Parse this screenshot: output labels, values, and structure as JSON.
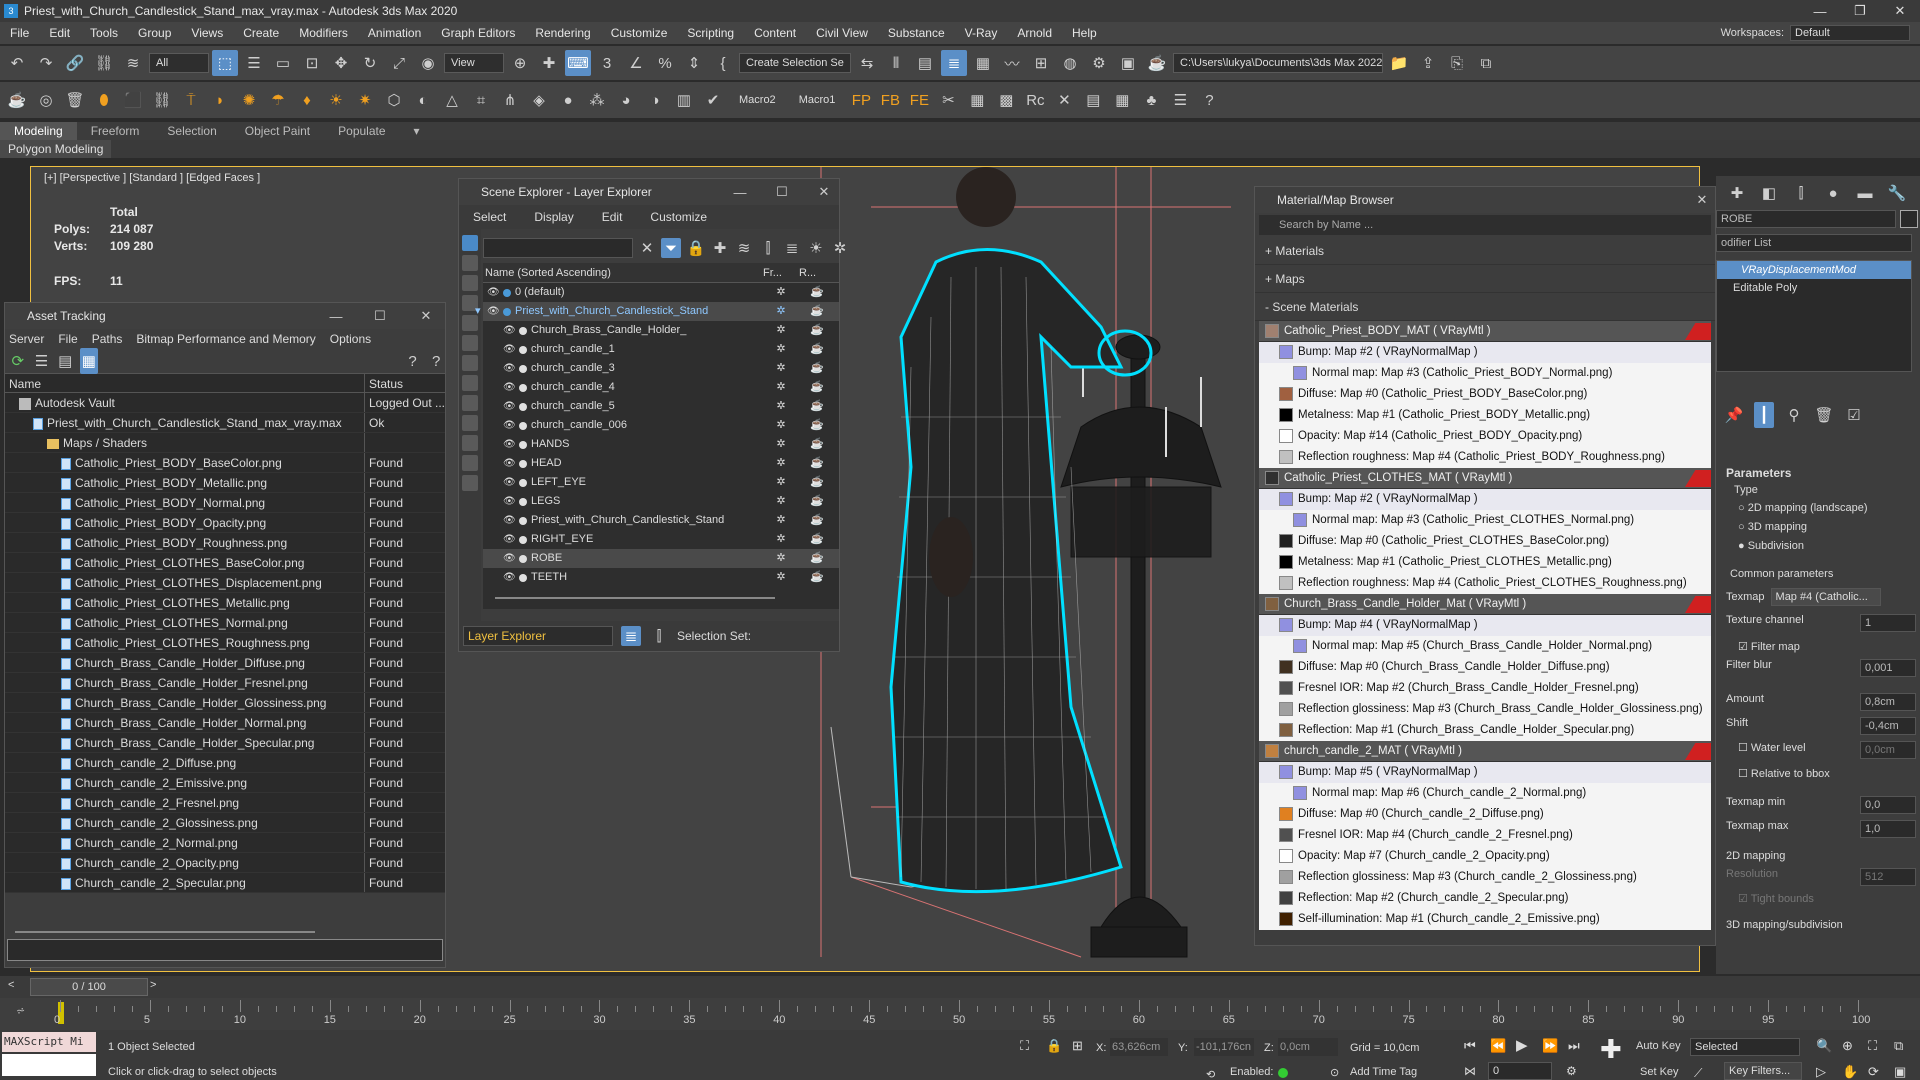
{
  "window": {
    "title": "Priest_with_Church_Candlestick_Stand_max_vray.max - Autodesk 3ds Max 2020"
  },
  "menu": [
    "File",
    "Edit",
    "Tools",
    "Group",
    "Views",
    "Create",
    "Modifiers",
    "Animation",
    "Graph Editors",
    "Rendering",
    "Customize",
    "Scripting",
    "Content",
    "Civil View",
    "Substance",
    "V-Ray",
    "Arnold",
    "Help"
  ],
  "workspace": {
    "label": "Workspaces:",
    "value": "Default"
  },
  "toolbar1": {
    "filter": "All",
    "refcoord": "View",
    "selection_set": "Create Selection Se",
    "project_path": "C:\\Users\\lukya\\Documents\\3ds Max 2022"
  },
  "toolbar2": {
    "macro2": "Macro2",
    "macro1": "Macro1"
  },
  "ribbon": {
    "tabs": [
      "Modeling",
      "Freeform",
      "Selection",
      "Object Paint",
      "Populate"
    ],
    "sub": "Polygon Modeling"
  },
  "viewport": {
    "label": "[+] [Perspective ] [Standard ] [Edged Faces ]",
    "stats": {
      "total": "Total",
      "polys_label": "Polys:",
      "polys": "214 087",
      "verts_label": "Verts:",
      "verts": "109 280",
      "fps_label": "FPS:",
      "fps": "11"
    }
  },
  "asset_tracking": {
    "title": "Asset Tracking",
    "menu": [
      "Server",
      "File",
      "Paths",
      "Bitmap Performance and Memory",
      "Options"
    ],
    "columns": [
      "Name",
      "Status"
    ],
    "rows": [
      {
        "name": "Autodesk Vault",
        "status": "Logged Out ...",
        "indent": 1,
        "kind": "vault"
      },
      {
        "name": "Priest_with_Church_Candlestick_Stand_max_vray.max",
        "status": "Ok",
        "indent": 2,
        "kind": "file"
      },
      {
        "name": "Maps / Shaders",
        "status": "",
        "indent": 3,
        "kind": "folder"
      },
      {
        "name": "Catholic_Priest_BODY_BaseColor.png",
        "status": "Found",
        "indent": 4,
        "kind": "file"
      },
      {
        "name": "Catholic_Priest_BODY_Metallic.png",
        "status": "Found",
        "indent": 4,
        "kind": "file"
      },
      {
        "name": "Catholic_Priest_BODY_Normal.png",
        "status": "Found",
        "indent": 4,
        "kind": "file"
      },
      {
        "name": "Catholic_Priest_BODY_Opacity.png",
        "status": "Found",
        "indent": 4,
        "kind": "file"
      },
      {
        "name": "Catholic_Priest_BODY_Roughness.png",
        "status": "Found",
        "indent": 4,
        "kind": "file"
      },
      {
        "name": "Catholic_Priest_CLOTHES_BaseColor.png",
        "status": "Found",
        "indent": 4,
        "kind": "file"
      },
      {
        "name": "Catholic_Priest_CLOTHES_Displacement.png",
        "status": "Found",
        "indent": 4,
        "kind": "file"
      },
      {
        "name": "Catholic_Priest_CLOTHES_Metallic.png",
        "status": "Found",
        "indent": 4,
        "kind": "file"
      },
      {
        "name": "Catholic_Priest_CLOTHES_Normal.png",
        "status": "Found",
        "indent": 4,
        "kind": "file"
      },
      {
        "name": "Catholic_Priest_CLOTHES_Roughness.png",
        "status": "Found",
        "indent": 4,
        "kind": "file"
      },
      {
        "name": "Church_Brass_Candle_Holder_Diffuse.png",
        "status": "Found",
        "indent": 4,
        "kind": "file"
      },
      {
        "name": "Church_Brass_Candle_Holder_Fresnel.png",
        "status": "Found",
        "indent": 4,
        "kind": "file"
      },
      {
        "name": "Church_Brass_Candle_Holder_Glossiness.png",
        "status": "Found",
        "indent": 4,
        "kind": "file"
      },
      {
        "name": "Church_Brass_Candle_Holder_Normal.png",
        "status": "Found",
        "indent": 4,
        "kind": "file"
      },
      {
        "name": "Church_Brass_Candle_Holder_Specular.png",
        "status": "Found",
        "indent": 4,
        "kind": "file"
      },
      {
        "name": "Church_candle_2_Diffuse.png",
        "status": "Found",
        "indent": 4,
        "kind": "file"
      },
      {
        "name": "Church_candle_2_Emissive.png",
        "status": "Found",
        "indent": 4,
        "kind": "file"
      },
      {
        "name": "Church_candle_2_Fresnel.png",
        "status": "Found",
        "indent": 4,
        "kind": "file"
      },
      {
        "name": "Church_candle_2_Glossiness.png",
        "status": "Found",
        "indent": 4,
        "kind": "file"
      },
      {
        "name": "Church_candle_2_Normal.png",
        "status": "Found",
        "indent": 4,
        "kind": "file"
      },
      {
        "name": "Church_candle_2_Opacity.png",
        "status": "Found",
        "indent": 4,
        "kind": "file"
      },
      {
        "name": "Church_candle_2_Specular.png",
        "status": "Found",
        "indent": 4,
        "kind": "file"
      }
    ]
  },
  "scene_explorer": {
    "title": "Scene Explorer - Layer Explorer",
    "menu": [
      "Select",
      "Display",
      "Edit",
      "Customize"
    ],
    "columns": [
      "Name (Sorted Ascending)",
      "Fr...",
      "R..."
    ],
    "rows": [
      {
        "name": "0 (default)",
        "indent": 1,
        "sel": false,
        "hl": false
      },
      {
        "name": "Priest_with_Church_Candlestick_Stand",
        "indent": 1,
        "sel": true,
        "hl": true
      },
      {
        "name": "Church_Brass_Candle_Holder_",
        "indent": 2,
        "sel": false,
        "hl": false
      },
      {
        "name": "church_candle_1",
        "indent": 2,
        "sel": false,
        "hl": false
      },
      {
        "name": "church_candle_3",
        "indent": 2,
        "sel": false,
        "hl": false
      },
      {
        "name": "church_candle_4",
        "indent": 2,
        "sel": false,
        "hl": false
      },
      {
        "name": "church_candle_5",
        "indent": 2,
        "sel": false,
        "hl": false
      },
      {
        "name": "church_candle_006",
        "indent": 2,
        "sel": false,
        "hl": false
      },
      {
        "name": "HANDS",
        "indent": 2,
        "sel": false,
        "hl": false
      },
      {
        "name": "HEAD",
        "indent": 2,
        "sel": false,
        "hl": false
      },
      {
        "name": "LEFT_EYE",
        "indent": 2,
        "sel": false,
        "hl": false
      },
      {
        "name": "LEGS",
        "indent": 2,
        "sel": false,
        "hl": false
      },
      {
        "name": "Priest_with_Church_Candlestick_Stand",
        "indent": 2,
        "sel": false,
        "hl": false
      },
      {
        "name": "RIGHT_EYE",
        "indent": 2,
        "sel": false,
        "hl": false
      },
      {
        "name": "ROBE",
        "indent": 2,
        "sel": true,
        "hl": false
      },
      {
        "name": "TEETH",
        "indent": 2,
        "sel": false,
        "hl": false
      }
    ],
    "footer": {
      "explorer": "Layer Explorer",
      "selection_set": "Selection Set:"
    }
  },
  "material_browser": {
    "title": "Material/Map Browser",
    "search_placeholder": "Search by Name ...",
    "groups": [
      "+ Materials",
      "+ Maps",
      "- Scene Materials"
    ],
    "rows": [
      {
        "text": "Catholic_Priest_BODY_MAT  ( VRayMtl )",
        "kind": "mat",
        "indent": 0,
        "swatch": "#a08070",
        "flag": true
      },
      {
        "text": "Bump: Map #2  ( VRayNormalMap )",
        "kind": "bump",
        "indent": 1,
        "swatch": "#9090e0",
        "flag": false
      },
      {
        "text": "Normal map: Map #3 (Catholic_Priest_BODY_Normal.png)",
        "kind": "sub",
        "indent": 2,
        "swatch": "#9090e0",
        "flag": false
      },
      {
        "text": "Diffuse: Map #0 (Catholic_Priest_BODY_BaseColor.png)",
        "kind": "sub",
        "indent": 1,
        "swatch": "#a06040",
        "flag": false
      },
      {
        "text": "Metalness: Map #1 (Catholic_Priest_BODY_Metallic.png)",
        "kind": "sub",
        "indent": 1,
        "swatch": "#000000",
        "flag": false
      },
      {
        "text": "Opacity: Map #14 (Catholic_Priest_BODY_Opacity.png)",
        "kind": "sub",
        "indent": 1,
        "swatch": "#ffffff",
        "flag": false
      },
      {
        "text": "Reflection roughness: Map #4 (Catholic_Priest_BODY_Roughness.png)",
        "kind": "sub",
        "indent": 1,
        "swatch": "#c0c0c0",
        "flag": false
      },
      {
        "text": "Catholic_Priest_CLOTHES_MAT  ( VRayMtl )",
        "kind": "mat",
        "indent": 0,
        "swatch": "#303030",
        "flag": true
      },
      {
        "text": "Bump: Map #2  ( VRayNormalMap )",
        "kind": "bump",
        "indent": 1,
        "swatch": "#9090e0",
        "flag": false
      },
      {
        "text": "Normal map: Map #3 (Catholic_Priest_CLOTHES_Normal.png)",
        "kind": "sub",
        "indent": 2,
        "swatch": "#9090e0",
        "flag": false
      },
      {
        "text": "Diffuse: Map #0 (Catholic_Priest_CLOTHES_BaseColor.png)",
        "kind": "sub",
        "indent": 1,
        "swatch": "#202020",
        "flag": false
      },
      {
        "text": "Metalness: Map #1 (Catholic_Priest_CLOTHES_Metallic.png)",
        "kind": "sub",
        "indent": 1,
        "swatch": "#000000",
        "flag": false
      },
      {
        "text": "Reflection roughness: Map #4 (Catholic_Priest_CLOTHES_Roughness.png)",
        "kind": "sub",
        "indent": 1,
        "swatch": "#c0c0c0",
        "flag": false
      },
      {
        "text": "Church_Brass_Candle_Holder_Mat  ( VRayMtl )",
        "kind": "mat",
        "indent": 0,
        "swatch": "#806040",
        "flag": true
      },
      {
        "text": "Bump: Map #4  ( VRayNormalMap )",
        "kind": "bump",
        "indent": 1,
        "swatch": "#9090e0",
        "flag": false
      },
      {
        "text": "Normal map: Map #5 (Church_Brass_Candle_Holder_Normal.png)",
        "kind": "sub",
        "indent": 2,
        "swatch": "#9090e0",
        "flag": false
      },
      {
        "text": "Diffuse: Map #0 (Church_Brass_Candle_Holder_Diffuse.png)",
        "kind": "sub",
        "indent": 1,
        "swatch": "#403020",
        "flag": false
      },
      {
        "text": "Fresnel IOR: Map #2 (Church_Brass_Candle_Holder_Fresnel.png)",
        "kind": "sub",
        "indent": 1,
        "swatch": "#505050",
        "flag": false
      },
      {
        "text": "Reflection glossiness: Map #3 (Church_Brass_Candle_Holder_Glossiness.png)",
        "kind": "sub",
        "indent": 1,
        "swatch": "#a0a0a0",
        "flag": false
      },
      {
        "text": "Reflection: Map #1 (Church_Brass_Candle_Holder_Specular.png)",
        "kind": "sub",
        "indent": 1,
        "swatch": "#806040",
        "flag": false
      },
      {
        "text": "church_candle_2_MAT  ( VRayMtl )",
        "kind": "mat",
        "indent": 0,
        "swatch": "#c08040",
        "flag": true
      },
      {
        "text": "Bump: Map #5  ( VRayNormalMap )",
        "kind": "bump",
        "indent": 1,
        "swatch": "#9090e0",
        "flag": false
      },
      {
        "text": "Normal map: Map #6 (Church_candle_2_Normal.png)",
        "kind": "sub",
        "indent": 2,
        "swatch": "#9090e0",
        "flag": false
      },
      {
        "text": "Diffuse: Map #0 (Church_candle_2_Diffuse.png)",
        "kind": "sub",
        "indent": 1,
        "swatch": "#e08020",
        "flag": false
      },
      {
        "text": "Fresnel IOR: Map #4 (Church_candle_2_Fresnel.png)",
        "kind": "sub",
        "indent": 1,
        "swatch": "#505050",
        "flag": false
      },
      {
        "text": "Opacity: Map #7 (Church_candle_2_Opacity.png)",
        "kind": "sub",
        "indent": 1,
        "swatch": "#ffffff",
        "flag": false
      },
      {
        "text": "Reflection glossiness: Map #3 (Church_candle_2_Glossiness.png)",
        "kind": "sub",
        "indent": 1,
        "swatch": "#a0a0a0",
        "flag": false
      },
      {
        "text": "Reflection: Map #2 (Church_candle_2_Specular.png)",
        "kind": "sub",
        "indent": 1,
        "swatch": "#404040",
        "flag": false
      },
      {
        "text": "Self-illumination: Map #1 (Church_candle_2_Emissive.png)",
        "kind": "sub",
        "indent": 1,
        "swatch": "#402000",
        "flag": false
      }
    ]
  },
  "command_panel": {
    "object_name": "ROBE",
    "modifier_list": "odifier List",
    "stack": [
      "VRayDisplacementMod",
      "Editable Poly"
    ],
    "params_title": "Parameters",
    "type_label": "Type",
    "types": [
      "2D mapping (landscape)",
      "3D mapping",
      "Subdivision"
    ],
    "common_label": "Common parameters",
    "texmap_label": "Texmap",
    "texmap_value": "Map #4 (Catholic...",
    "tex_channel_label": "Texture channel",
    "tex_channel": "1",
    "filter_map": "Filter map",
    "filter_blur_label": "Filter blur",
    "filter_blur": "0,001",
    "amount_label": "Amount",
    "amount": "0,8cm",
    "shift_label": "Shift",
    "shift": "-0,4cm",
    "water_label": "Water level",
    "water": "0,0cm",
    "relative_bbox": "Relative to bbox",
    "texmap_min_label": "Texmap min",
    "texmap_min": "0,0",
    "texmap_max_label": "Texmap max",
    "texmap_max": "1,0",
    "map2d_label": "2D mapping",
    "resolution_label": "Resolution",
    "resolution": "512",
    "tight_bounds": "Tight bounds",
    "map3d_label": "3D mapping/subdivision"
  },
  "timeline": {
    "frame": "0 / 100",
    "ticks": [
      "0",
      "5",
      "10",
      "15",
      "20",
      "25",
      "30",
      "35",
      "40",
      "45",
      "50",
      "55",
      "60",
      "65",
      "70",
      "75",
      "80",
      "85",
      "90",
      "95",
      "100"
    ]
  },
  "status": {
    "maxscript": "MAXScript Mi",
    "selected": "1 Object Selected",
    "prompt": "Click or click-drag to select objects",
    "x_label": "X:",
    "x": "63,626cm",
    "y_label": "Y:",
    "y": "-101,176cn",
    "z_label": "Z:",
    "z": "0,0cm",
    "grid": "Grid = 10,0cm",
    "enabled": "Enabled:",
    "add_time_tag": "Add Time Tag",
    "auto_key": "Auto Key",
    "selected_dd": "Selected",
    "set_key": "Set Key",
    "key_filters": "Key Filters...",
    "frame_field": "0"
  },
  "colors": {
    "accent": "#5b8fc7",
    "selection_highlight": "#00e0ff",
    "active_viewport_border": "#f0c040"
  }
}
